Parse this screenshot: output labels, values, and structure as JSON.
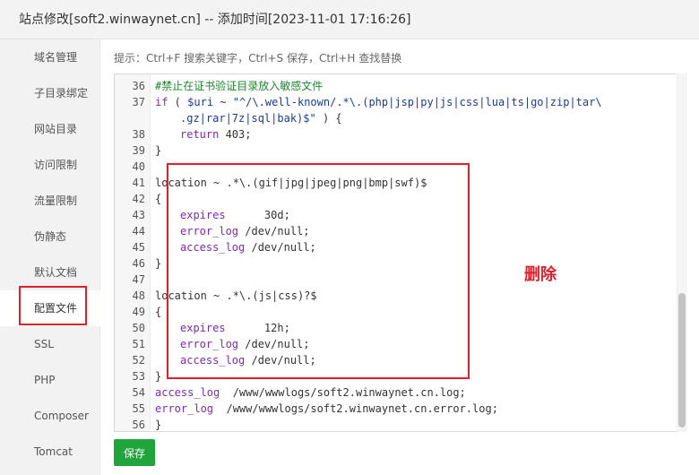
{
  "window": {
    "title": "站点修改[soft2.winwaynet.cn] -- 添加时间[2023-11-01 17:16:26]"
  },
  "sidebar": {
    "items": [
      {
        "label": "域名管理"
      },
      {
        "label": "子目录绑定"
      },
      {
        "label": "网站目录"
      },
      {
        "label": "访问限制"
      },
      {
        "label": "流量限制"
      },
      {
        "label": "伪静态"
      },
      {
        "label": "默认文档"
      },
      {
        "label": "配置文件",
        "active": true
      },
      {
        "label": "SSL"
      },
      {
        "label": "PHP"
      },
      {
        "label": "Composer"
      },
      {
        "label": "Tomcat"
      }
    ]
  },
  "hint": "提示：Ctrl+F 搜索关键字，Ctrl+S 保存，Ctrl+H 查找替换",
  "editor": {
    "lines": [
      {
        "n": "36",
        "indent": 1,
        "tokens": [
          {
            "t": "#禁止在证书验证目录放入敏感文件",
            "c": "cm"
          }
        ]
      },
      {
        "n": "37",
        "indent": 1,
        "tokens": [
          {
            "t": "if",
            "c": "kw"
          },
          {
            "t": " ( "
          },
          {
            "t": "$uri",
            "c": "var"
          },
          {
            "t": " ~ "
          },
          {
            "t": "\"^/\\.well-known/.*\\.(php|jsp|py|js|css|lua|ts|go|zip|tar\\",
            "c": "str"
          }
        ]
      },
      {
        "n": "",
        "indent": 2,
        "tokens": [
          {
            "t": ".gz|rar|7z|sql|bak)$\"",
            "c": "str"
          },
          {
            "t": " ) {"
          }
        ]
      },
      {
        "n": "38",
        "indent": 2,
        "tokens": [
          {
            "t": "return",
            "c": "kw"
          },
          {
            "t": " 403;"
          }
        ]
      },
      {
        "n": "39",
        "indent": 1,
        "tokens": [
          {
            "t": "}"
          }
        ]
      },
      {
        "n": "40",
        "indent": 0,
        "tokens": []
      },
      {
        "n": "41",
        "indent": 1,
        "tokens": [
          {
            "t": "location ~ .*\\.(gif|jpg|jpeg|png|bmp|swf)$"
          }
        ]
      },
      {
        "n": "42",
        "indent": 1,
        "tokens": [
          {
            "t": "{"
          }
        ]
      },
      {
        "n": "43",
        "indent": 2,
        "tokens": [
          {
            "t": "expires",
            "c": "dir"
          },
          {
            "t": "      30d;"
          }
        ]
      },
      {
        "n": "44",
        "indent": 2,
        "tokens": [
          {
            "t": "error_log",
            "c": "dir"
          },
          {
            "t": " /dev/null;"
          }
        ]
      },
      {
        "n": "45",
        "indent": 2,
        "tokens": [
          {
            "t": "access_log",
            "c": "dir"
          },
          {
            "t": " /dev/null;"
          }
        ]
      },
      {
        "n": "46",
        "indent": 1,
        "tokens": [
          {
            "t": "}"
          }
        ]
      },
      {
        "n": "47",
        "indent": 0,
        "tokens": []
      },
      {
        "n": "48",
        "indent": 1,
        "tokens": [
          {
            "t": "location ~ .*\\.(js|css)?$"
          }
        ]
      },
      {
        "n": "49",
        "indent": 1,
        "tokens": [
          {
            "t": "{"
          }
        ]
      },
      {
        "n": "50",
        "indent": 2,
        "tokens": [
          {
            "t": "expires",
            "c": "dir"
          },
          {
            "t": "      12h;"
          }
        ]
      },
      {
        "n": "51",
        "indent": 2,
        "tokens": [
          {
            "t": "error_log",
            "c": "dir"
          },
          {
            "t": " /dev/null;"
          }
        ]
      },
      {
        "n": "52",
        "indent": 2,
        "tokens": [
          {
            "t": "access_log",
            "c": "dir"
          },
          {
            "t": " /dev/null;"
          }
        ]
      },
      {
        "n": "53",
        "indent": 1,
        "tokens": [
          {
            "t": "}"
          }
        ]
      },
      {
        "n": "54",
        "indent": 1,
        "tokens": [
          {
            "t": "access_log",
            "c": "dir"
          },
          {
            "t": "  /www/wwwlogs/soft2.winwaynet.cn.log;"
          }
        ]
      },
      {
        "n": "55",
        "indent": 1,
        "tokens": [
          {
            "t": "error_log",
            "c": "dir"
          },
          {
            "t": "  /www/wwwlogs/soft2.winwaynet.cn.error.log;"
          }
        ]
      },
      {
        "n": "56",
        "indent": 0,
        "tokens": [
          {
            "t": "}"
          }
        ]
      }
    ]
  },
  "annotation": "删除",
  "save_label": "保存",
  "colors": {
    "accent_red": "#e3202a",
    "save_green": "#20a53a"
  }
}
